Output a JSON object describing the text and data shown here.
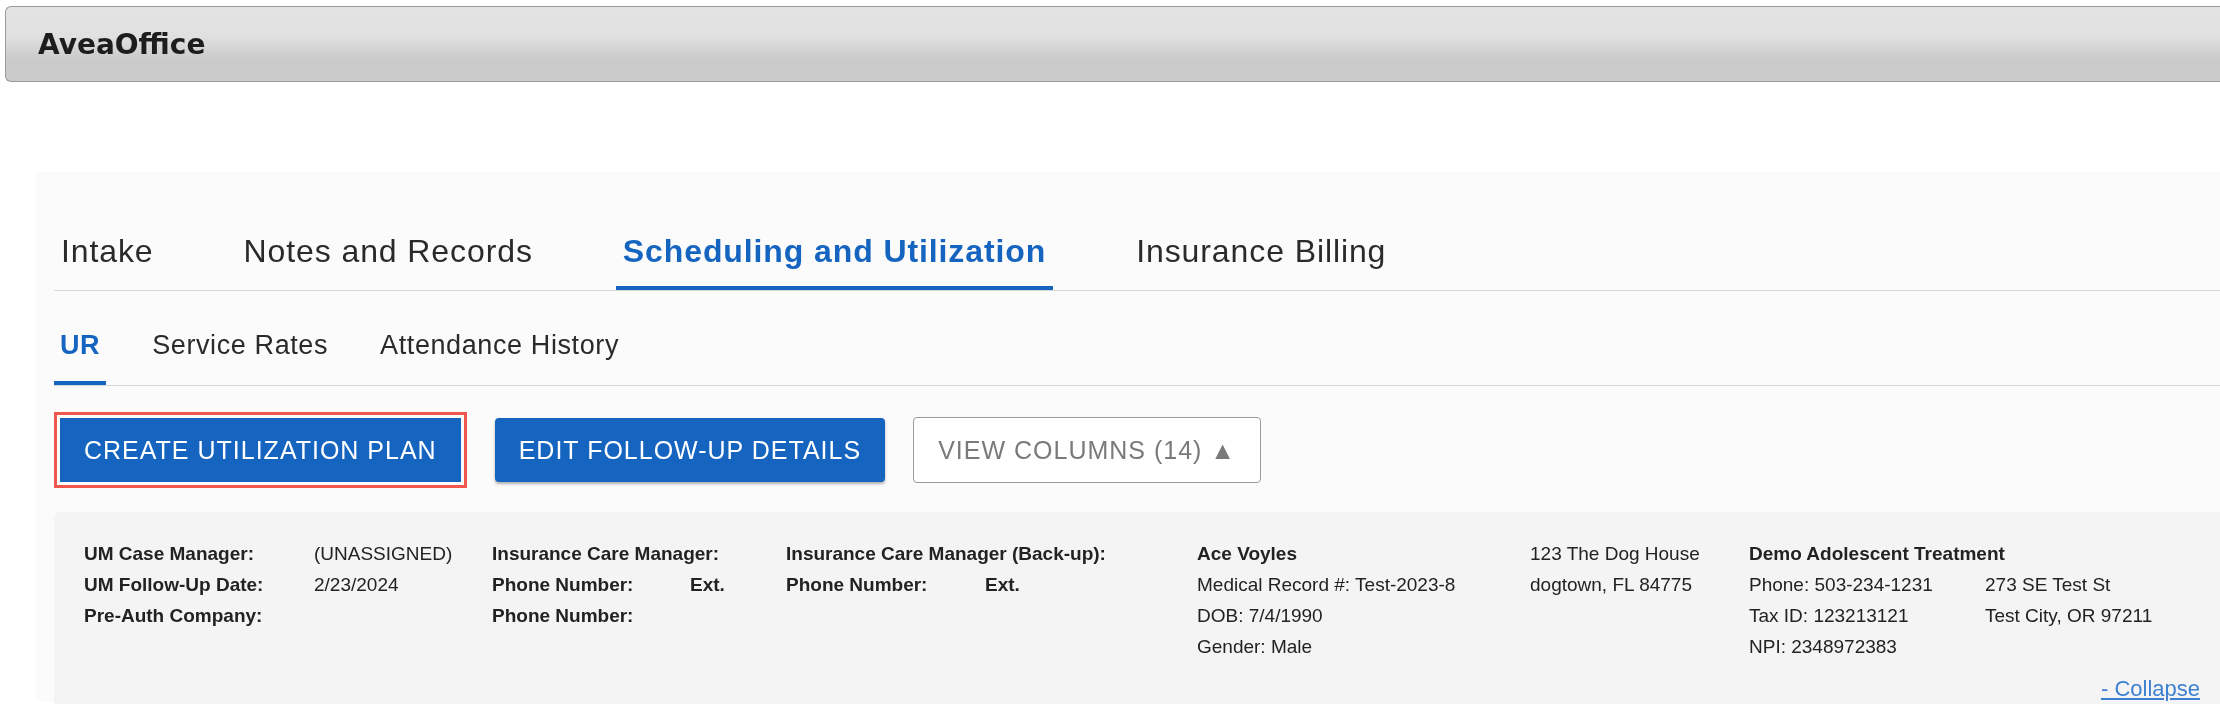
{
  "window": {
    "title": "AveaOffice"
  },
  "tabs": [
    {
      "label": "Intake",
      "selected": false
    },
    {
      "label": "Notes and Records",
      "selected": false
    },
    {
      "label": "Scheduling and Utilization",
      "selected": true
    },
    {
      "label": "Insurance Billing",
      "selected": false
    }
  ],
  "subtabs": [
    {
      "label": "UR",
      "selected": true
    },
    {
      "label": "Service Rates",
      "selected": false
    },
    {
      "label": "Attendance History",
      "selected": false
    }
  ],
  "actions": [
    {
      "label": "CREATE UTILIZATION PLAN",
      "kind": "primary",
      "highlighted": true
    },
    {
      "label": "EDIT FOLLOW-UP DETAILS",
      "kind": "primary",
      "highlighted": false
    },
    {
      "label": "VIEW COLUMNS (14) ▲",
      "kind": "outline",
      "highlighted": false
    }
  ],
  "details": {
    "blocks": [
      {
        "kind": "fields",
        "rows": [
          {
            "label": "UM Case Manager:",
            "value": "(UNASSIGNED)"
          },
          {
            "label": "UM Follow-Up Date:",
            "value": "2/23/2024"
          },
          {
            "label": "Pre-Auth Company:"
          }
        ]
      },
      {
        "kind": "fields",
        "rows": [
          {
            "label": "Insurance Care Manager:"
          },
          {
            "label": "Phone Number:",
            "value": "Ext."
          },
          {
            "label": "Phone Number:"
          }
        ]
      },
      {
        "kind": "fields",
        "rows": [
          {
            "label": "Insurance Care Manager (Back-up):"
          },
          {
            "label": "Phone Number:",
            "value": "Ext."
          }
        ]
      },
      {
        "kind": "contact",
        "title": "Ace Voyles",
        "lines": [
          "Medical Record #: Test-2023-8",
          "DOB: 7/4/1990",
          "Gender: Male"
        ]
      },
      {
        "kind": "contact",
        "lines": [
          "123 The Dog House",
          "dogtown, FL 84775"
        ]
      },
      {
        "kind": "contact",
        "title": "Demo Adolescent Treatment",
        "lines": [
          "Phone: 503-234-1231",
          "Tax ID: 123213121",
          "NPI: 2348972383"
        ],
        "side_lines": [
          "273 SE Test St",
          "Test City, OR 97211"
        ]
      }
    ],
    "collapse_link": "- Collapse"
  }
}
